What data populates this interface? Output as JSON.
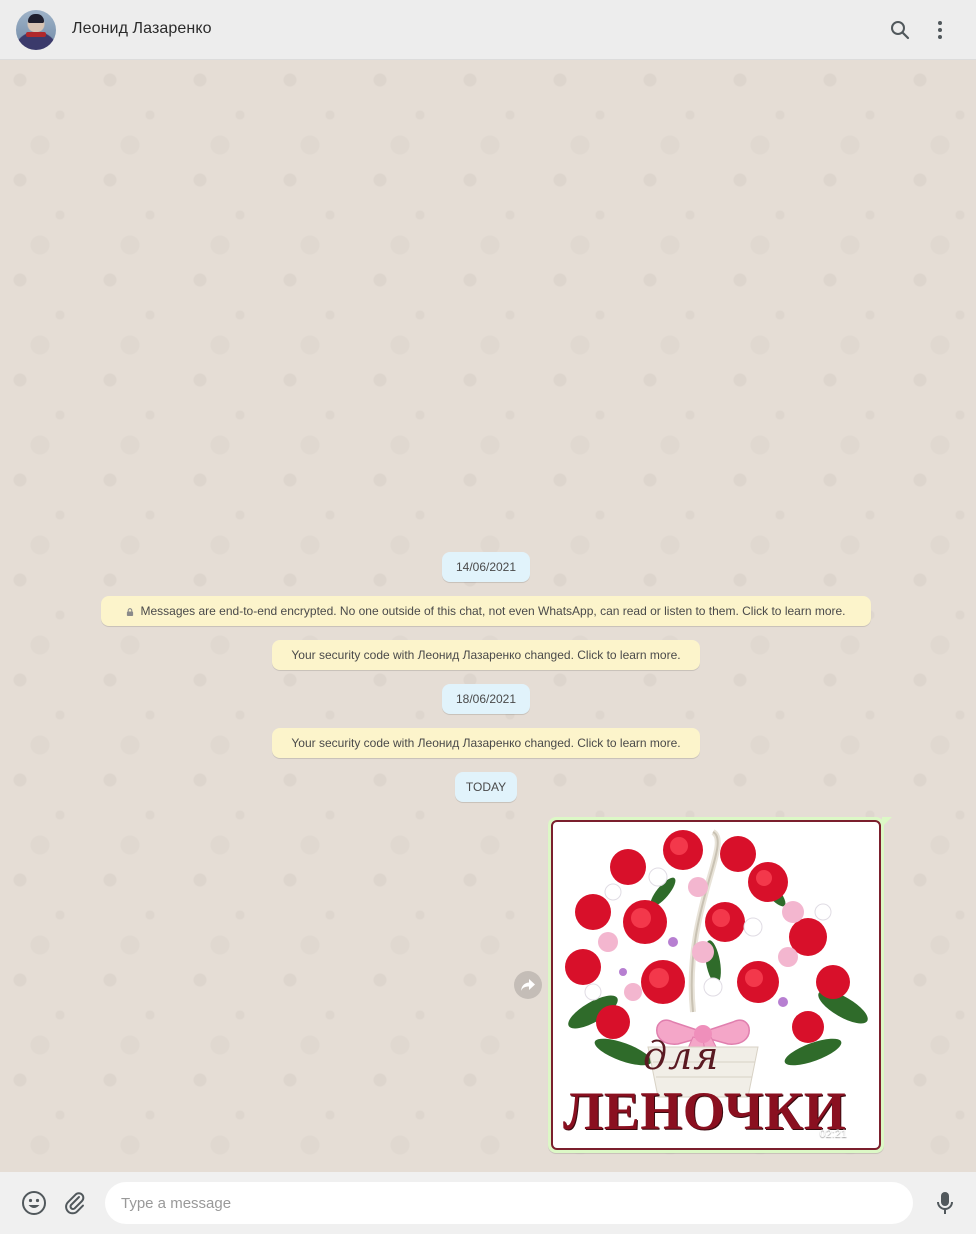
{
  "header": {
    "contact_name": "Леонид Лазаренко",
    "icons": [
      "avatar",
      "search-icon",
      "menu-icon"
    ]
  },
  "messages": {
    "date1": "14/06/2021",
    "encryption_notice": "Messages are end-to-end encrypted. No one outside of this chat, not even WhatsApp, can read or listen to them. Click to learn more.",
    "security_notice1": "Your security code with Леонид Лазаренко changed. Click to learn more.",
    "date2": "18/06/2021",
    "security_notice2": "Your security code with Леонид Лазаренко changed. Click to learn more.",
    "date3": "TODAY",
    "image_message": {
      "caption_small": "для",
      "caption_big": "ЛЕНОЧКИ",
      "time": "02:21",
      "status": "read"
    }
  },
  "footer": {
    "placeholder": "Type a message",
    "icons": [
      "emoji-icon",
      "paperclip-icon",
      "mic-icon"
    ]
  },
  "colors": {
    "header_bg": "#ededed",
    "chat_bg": "#e5ddd5",
    "date_pill": "#e1f3fb",
    "notice_pill": "#fcf4cb",
    "outgoing_bubble": "#dcf8c6",
    "footer_bg": "#f0f0f0"
  }
}
